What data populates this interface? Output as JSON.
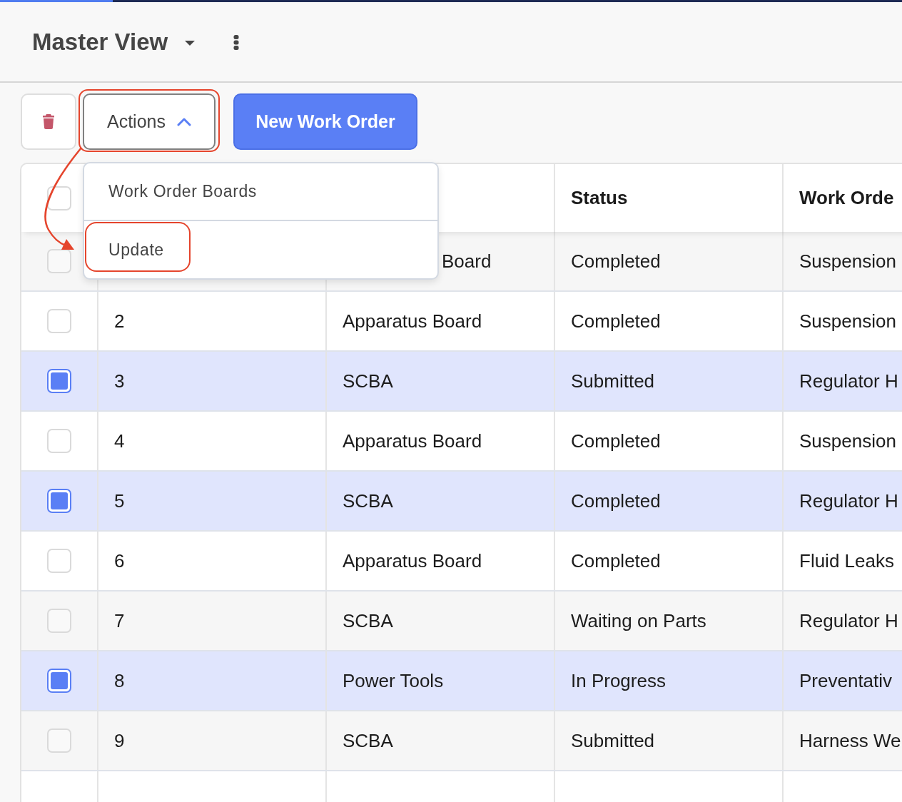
{
  "loading_bar": {
    "level": 0.125
  },
  "header": {
    "title": "Master View"
  },
  "toolbar": {
    "actions_button": {
      "label": "Actions",
      "expanded": true,
      "annotated": true
    },
    "new_button": {
      "label": "New Work Order"
    }
  },
  "actions_menu": {
    "items": [
      {
        "label": "Work Order Boards",
        "annotated": false
      },
      {
        "label": "Update",
        "annotated": true
      }
    ]
  },
  "table": {
    "select_all": {
      "checked": false
    },
    "header": {
      "status": "Status",
      "column_5": "Work Orde"
    },
    "rows": [
      {
        "selected": false,
        "column_3": "Board",
        "status": "Completed",
        "column_5": "Suspension"
      },
      {
        "selected": false,
        "column_2": "2",
        "column_3": "Apparatus Board",
        "status": "Completed",
        "column_5": "Suspension"
      },
      {
        "selected": true,
        "column_2": "3",
        "column_3": "SCBA",
        "status": "Submitted",
        "column_5": "Regulator H"
      },
      {
        "selected": false,
        "column_2": "4",
        "column_3": "Apparatus Board",
        "status": "Completed",
        "column_5": "Suspension"
      },
      {
        "selected": true,
        "column_2": "5",
        "column_3": "SCBA",
        "status": "Completed",
        "column_5": "Regulator H"
      },
      {
        "selected": false,
        "column_2": "6",
        "column_3": "Apparatus Board",
        "status": "Completed",
        "column_5": "Fluid Leaks"
      },
      {
        "selected": false,
        "column_2": "7",
        "column_3": "SCBA",
        "status": "Waiting on Parts",
        "column_5": "Regulator H"
      },
      {
        "selected": true,
        "column_2": "8",
        "column_3": "Power Tools",
        "status": "In Progress",
        "column_5": "Preventativ"
      },
      {
        "selected": false,
        "column_2": "9",
        "column_3": "SCBA",
        "status": "Submitted",
        "column_5": "Harness We"
      }
    ]
  }
}
